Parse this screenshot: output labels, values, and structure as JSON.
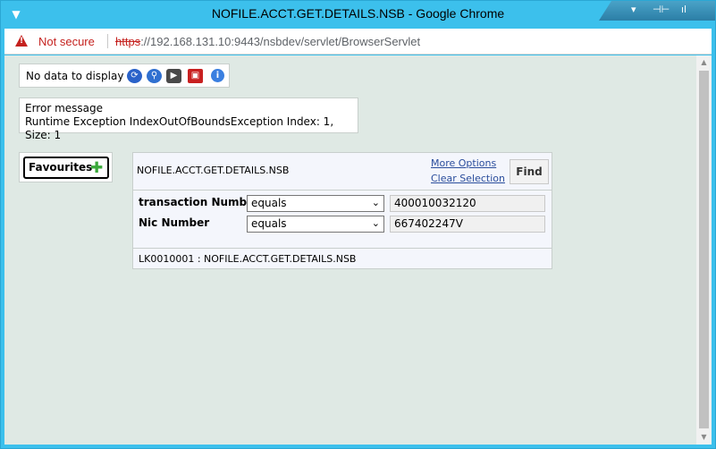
{
  "window": {
    "title": "NOFILE.ACCT.GET.DETAILS.NSB - Google Chrome",
    "controls": [
      "▾",
      "⊣⊢",
      "ıl"
    ]
  },
  "address_bar": {
    "security_label": "Not secure",
    "url_scheme": "https",
    "url_rest": "://192.168.131.10:9443/nsbdev/servlet/BrowserServlet"
  },
  "toolbar": {
    "no_data_label": "No data to display",
    "icons": [
      "refresh-icon",
      "search-icon",
      "next-icon",
      "toolbox-icon",
      "info-icon"
    ]
  },
  "error": {
    "heading": "Error message",
    "message": "Runtime Exception IndexOutOfBoundsException Index: 1, Size: 1"
  },
  "favourites": {
    "label": "Favourites"
  },
  "enquiry": {
    "title": "NOFILE.ACCT.GET.DETAILS.NSB",
    "more_options": "More Options",
    "clear_selection": "Clear Selection",
    "find_label": "Find",
    "criteria": [
      {
        "label": "transaction Number",
        "operator": "equals",
        "value": "400010032120"
      },
      {
        "label": "Nic Number",
        "operator": "equals",
        "value": "667402247V"
      }
    ],
    "footer": "LK0010001 : NOFILE.ACCT.GET.DETAILS.NSB"
  }
}
